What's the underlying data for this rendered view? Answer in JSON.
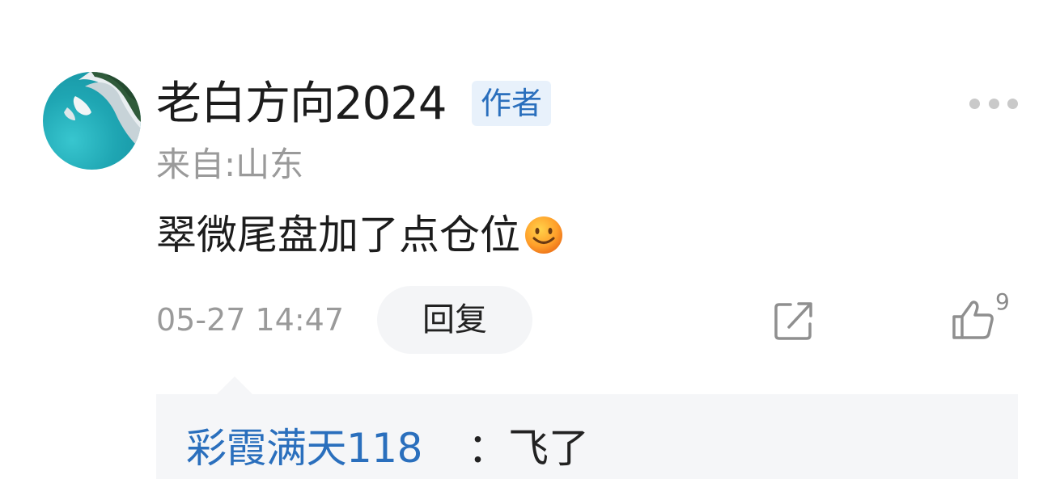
{
  "comment": {
    "username": "老白方向2024",
    "author_badge": "作者",
    "location": "来自:山东",
    "text": "翠微尾盘加了点仓位",
    "emoji": "smile-emoji",
    "timestamp": "05-27 14:47",
    "reply_label": "回复",
    "like_count": "9",
    "icons": {
      "more": "more-dots-icon",
      "share": "share-icon",
      "like": "thumbs-up-icon"
    },
    "accent_color": "#2a6fbd"
  },
  "replies": [
    {
      "user": "彩霞满天118",
      "separator": "：",
      "text": "飞了"
    }
  ]
}
